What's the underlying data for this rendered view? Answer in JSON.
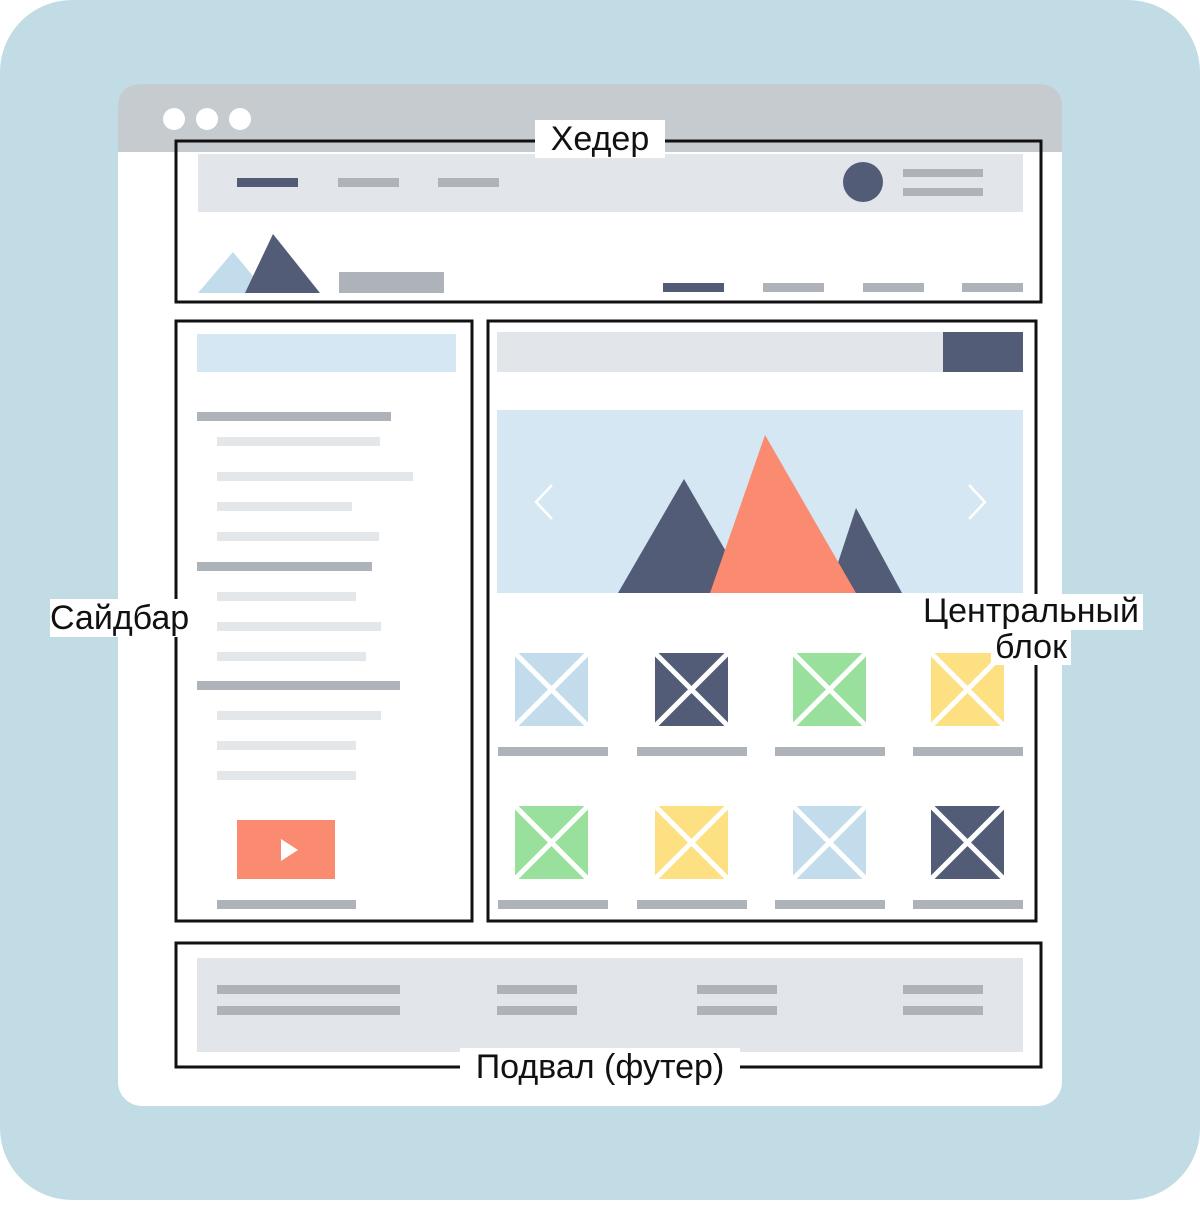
{
  "colors": {
    "background": "#c2dce6",
    "window": "#ffffff",
    "titlebar": "#c6cbcf",
    "outline": "#111111",
    "bar_light": "#e2e6ea",
    "bar_gray": "#adb3b8",
    "bar_faint": "#e4e7ea",
    "navy": "#525c76",
    "light_blue": "#d4e7f3",
    "pale_blue": "#c3dceb",
    "coral": "#fa8a70",
    "green": "#98e09c",
    "yellow": "#fde082"
  },
  "labels": {
    "header": "Хедер",
    "sidebar": "Сайдбар",
    "main_line1": "Центральный",
    "main_line2": "блок",
    "footer": "Подвал (футер)"
  },
  "window": {
    "controls": [
      "dot-icon",
      "dot-icon",
      "dot-icon"
    ]
  },
  "header": {
    "top_nav_items": 3,
    "active_nav_index": 0,
    "menu_items": 4,
    "active_menu_index": 0
  },
  "sidebar": {
    "groups": [
      {
        "items": 4
      },
      {
        "items": 3
      },
      {
        "items": 3
      }
    ],
    "video_icon": "play-icon"
  },
  "main": {
    "hero_icons": [
      "chevron-left-icon",
      "mountain-icon",
      "chevron-right-icon"
    ],
    "thumbnail_rows": [
      [
        "pale_blue",
        "navy",
        "green",
        "yellow"
      ],
      [
        "green",
        "yellow",
        "pale_blue",
        "navy"
      ]
    ],
    "thumbnail_icon": "image-placeholder-icon"
  },
  "footer": {
    "columns": 4
  }
}
